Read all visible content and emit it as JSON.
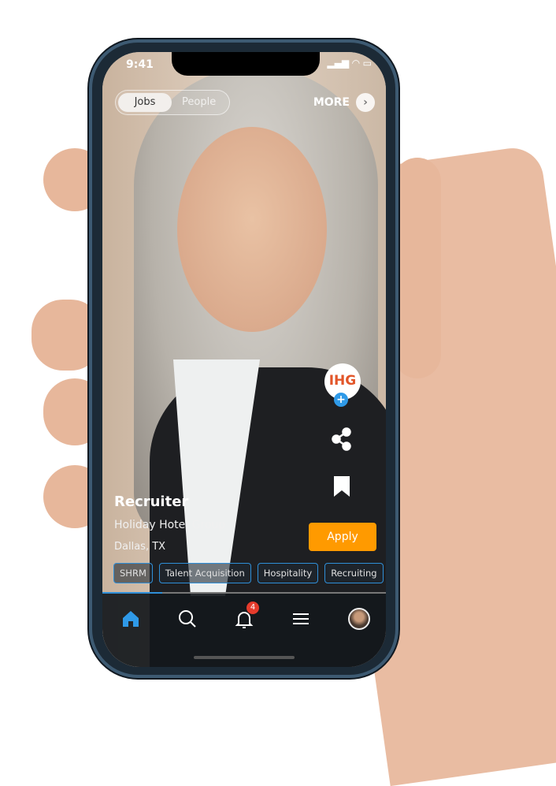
{
  "status_bar": {
    "time": "9:41"
  },
  "header": {
    "tabs": [
      {
        "label": "Jobs",
        "active": true
      },
      {
        "label": "People",
        "active": false
      }
    ],
    "more_label": "MORE"
  },
  "side_actions": {
    "company_logo": "IHG",
    "follow_icon": "plus-icon",
    "share_icon": "share-icon",
    "bookmark_icon": "bookmark-icon"
  },
  "job": {
    "title": "Recruiter",
    "company": "Holiday Hotel Group",
    "location": "Dallas, TX",
    "apply_label": "Apply",
    "tags": [
      "SHRM",
      "Talent Acquisition",
      "Hospitality",
      "Recruiting"
    ]
  },
  "progress": 0.21,
  "bottom_nav": {
    "items": [
      "home",
      "search",
      "notifications",
      "menu",
      "profile"
    ],
    "notification_count": "4",
    "active": "home"
  },
  "colors": {
    "accent": "#2f8fd8",
    "apply": "#ff9a00",
    "badge": "#e53b2c"
  }
}
